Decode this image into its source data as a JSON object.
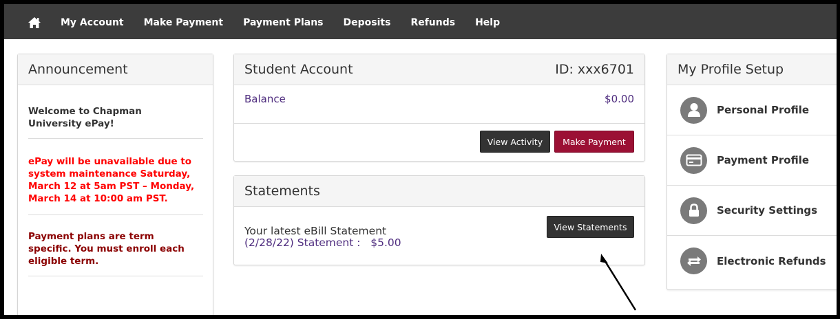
{
  "nav": {
    "home_icon": "home-icon",
    "items": [
      "My Account",
      "Make Payment",
      "Payment Plans",
      "Deposits",
      "Refunds",
      "Help"
    ]
  },
  "announcement": {
    "title": "Announcement",
    "messages": [
      {
        "text": "Welcome to Chapman University ePay!",
        "color": "#333333"
      },
      {
        "text": "ePay will be unavailable due to system maintenance Saturday, March 12 at 5am PST – Monday, March 14 at 10:00 am PST.",
        "color": "#ff0000"
      },
      {
        "text": "Payment plans are term specific. You must enroll each eligible term.",
        "color": "#8b0000"
      }
    ]
  },
  "student_account": {
    "title": "Student Account",
    "id_label": "ID: xxx6701",
    "balance_label": "Balance",
    "balance_value": "$0.00",
    "view_activity_label": "View Activity",
    "make_payment_label": "Make Payment"
  },
  "statements": {
    "title": "Statements",
    "latest_label": "Your latest eBill Statement",
    "statement_line": "(2/28/22) Statement :   $5.00",
    "view_statements_label": "View Statements"
  },
  "profile": {
    "title": "My Profile Setup",
    "items": [
      {
        "label": "Personal Profile",
        "icon": "person-icon"
      },
      {
        "label": "Payment Profile",
        "icon": "credit-card-icon"
      },
      {
        "label": "Security Settings",
        "icon": "lock-icon"
      },
      {
        "label": "Electronic Refunds",
        "icon": "refund-arrows-icon"
      }
    ]
  },
  "colors": {
    "nav_bg": "#3c3c3c",
    "accent_purple": "#4f2d7f",
    "button_red": "#9b1034",
    "button_dark": "#333333",
    "alert_red": "#ff0000",
    "dark_red": "#8b0000"
  }
}
